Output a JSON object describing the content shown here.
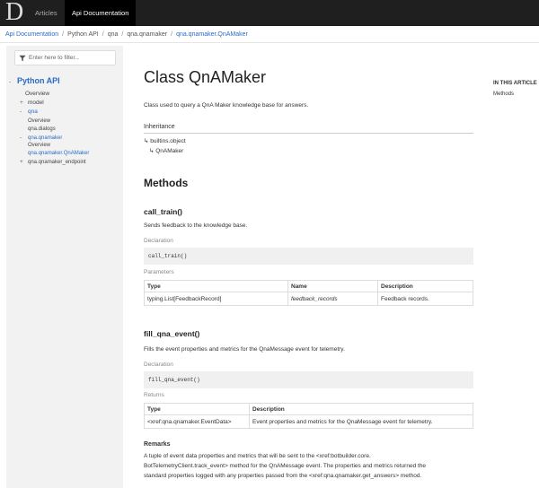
{
  "nav": {
    "logo_letter": "D",
    "items": [
      "Articles",
      "Api Documentation"
    ]
  },
  "breadcrumb": [
    "Api Documentation",
    "Python API",
    "qna",
    "qna.qnamaker",
    "qna.qnamaker.QnAMaker"
  ],
  "sidebar": {
    "filter_placeholder": "Enter here to filter...",
    "toc": {
      "root": "Python API",
      "overview": "Overview",
      "model": "model",
      "qna": "qna",
      "qna_overview": "Overview",
      "qna_dialogs": "qna.dialogs",
      "qna_qnamaker": "qna.qnamaker",
      "qnamaker_overview": "Overview",
      "qnamaker_class": "qna.qnamaker.QnAMaker",
      "qnamaker_endpoint": "qna.qnamaker_endpoint"
    }
  },
  "main": {
    "title": "Class QnAMaker",
    "summary": "Class used to query a QnA Maker knowledge base for answers.",
    "inheritance": {
      "heading": "Inheritance",
      "items": [
        "↳ builtins.object",
        "↳ QnAMaker"
      ]
    },
    "methods_heading": "Methods",
    "call_train": {
      "name": "call_train()",
      "description": "Sends feedback to the knowledge base.",
      "declaration_label": "Declaration",
      "declaration": "call_train()",
      "parameters_label": "Parameters",
      "columns": [
        "Type",
        "Name",
        "Description"
      ],
      "rows": [
        [
          "typing.List[FeedbackRecord]",
          "feedback_records",
          "Feedback records."
        ]
      ]
    },
    "fill_qna_event": {
      "name": "fill_qna_event()",
      "description": "Fills the event properties and metrics for the QnaMessage event for telemetry.",
      "declaration_label": "Declaration",
      "declaration": "fill_qna_event()",
      "returns_label": "Returns",
      "columns": [
        "Type",
        "Description"
      ],
      "rows": [
        [
          "<xref:qna.qnamaker.EventData>",
          "Event properties and metrics for the QnaMessage event for telemetry."
        ]
      ]
    },
    "remarks": {
      "heading": "Remarks",
      "lines": [
        "A tuple of event data properties and metrics that will be sent to the <xref:botbuilder.core.",
        "BotTelemetryClient.track_event> method for the QnAMessage event. The properties and metrics returned the",
        "standard properties logged with any properties passed from the <xref:qna.qnamaker.get_answers> method."
      ]
    }
  },
  "rail": {
    "title": "IN THIS ARTICLE",
    "links": [
      "Methods"
    ]
  }
}
